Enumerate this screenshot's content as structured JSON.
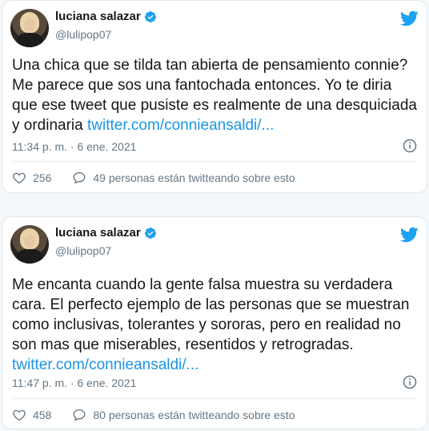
{
  "tweets": [
    {
      "name": "luciana salazar",
      "handle": "@lulipop07",
      "text": "Una chica que se tilda tan abierta de pensamiento connie? Me parece que sos una fantochada entonces. Yo te diria que ese tweet que pusiste es realmente de una desquiciada y ordinaria ",
      "link": "twitter.com/connieansaldi/...",
      "timestamp": "11:34 p. m. · 6 ene. 2021",
      "likes": "256",
      "talking": "49 personas están twitteando sobre esto"
    },
    {
      "name": "luciana salazar",
      "handle": "@lulipop07",
      "text": "Me encanta cuando la gente falsa muestra su verdadera cara. El perfecto ejemplo de las personas que se muestran como inclusivas, tolerantes y sororas, pero en realidad no son mas que miserables, resentidos y retrogradas. ",
      "link": "twitter.com/connieansaldi/...",
      "timestamp": "11:47 p. m. · 6 ene. 2021",
      "likes": "458",
      "talking": "80 personas están twitteando sobre esto"
    }
  ],
  "colors": {
    "accent": "#1da1f2",
    "link": "#1b95e0",
    "muted": "#657786",
    "text": "#14171a",
    "border": "#e1e8ed"
  },
  "icons": [
    "verified-badge-icon",
    "twitter-bird-icon",
    "info-icon",
    "heart-icon",
    "speech-bubble-icon"
  ]
}
